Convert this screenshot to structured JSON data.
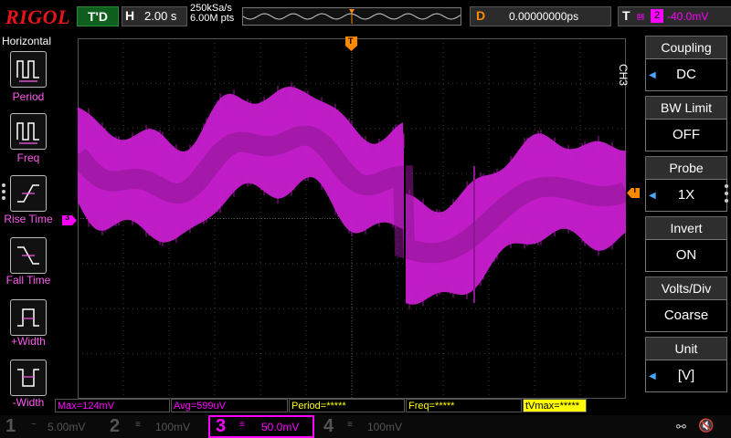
{
  "header": {
    "logo": "RIGOL",
    "trigger_status": "T'D",
    "timebase_label": "H",
    "timebase_value": "2.00 s",
    "sample_rate": "250kSa/s",
    "memory_depth": "6.00M pts",
    "delay_label": "D",
    "delay_value": "0.00000000ps",
    "trigger_label": "T",
    "trigger_source": "2",
    "trigger_level": "-40.0mV"
  },
  "left_menu": {
    "title": "Horizontal",
    "items": [
      {
        "label": "Period",
        "icon": "period-icon"
      },
      {
        "label": "Freq",
        "icon": "freq-icon"
      },
      {
        "label": "Rise Time",
        "icon": "rise-time-icon"
      },
      {
        "label": "Fall Time",
        "icon": "fall-time-icon"
      },
      {
        "label": "+Width",
        "icon": "positive-width-icon"
      },
      {
        "label": "-Width",
        "icon": "negative-width-icon"
      }
    ]
  },
  "right_menu": {
    "channel": "CH3",
    "items": [
      {
        "title": "Coupling",
        "value": "DC",
        "has_arrow": true
      },
      {
        "title": "BW Limit",
        "value": "OFF",
        "has_arrow": false
      },
      {
        "title": "Probe",
        "value": "1X",
        "has_arrow": true
      },
      {
        "title": "Invert",
        "value": "ON",
        "has_arrow": false
      },
      {
        "title": "Volts/Div",
        "value": "Coarse",
        "has_arrow": false
      },
      {
        "title": "Unit",
        "value": "[V]",
        "has_arrow": true
      }
    ]
  },
  "markers": {
    "channel3_marker": "3",
    "trigger_marker": "T"
  },
  "measurements": {
    "max": "Max=124mV",
    "avg": "Avg=599uV",
    "period": "Period=*****",
    "freq": "Freq=*****",
    "vmax": "tVmax=*****"
  },
  "channels": [
    {
      "num": "1",
      "scale": "5.00mV",
      "active": false,
      "color": "#ffff00"
    },
    {
      "num": "2",
      "scale": "100mV",
      "active": false,
      "color": "#00ffff"
    },
    {
      "num": "3",
      "scale": "50.0mV",
      "active": true,
      "color": "#ff00ff"
    },
    {
      "num": "4",
      "scale": "100mV",
      "active": false,
      "color": "#3399ff"
    }
  ],
  "colors": {
    "trace": "#c81ed0",
    "trace_core": "#8a1690",
    "accent_orange": "#ff8a00",
    "menu_blue": "#4aa6ff"
  },
  "status_icons": [
    "usb-icon",
    "speaker-muted-icon"
  ]
}
